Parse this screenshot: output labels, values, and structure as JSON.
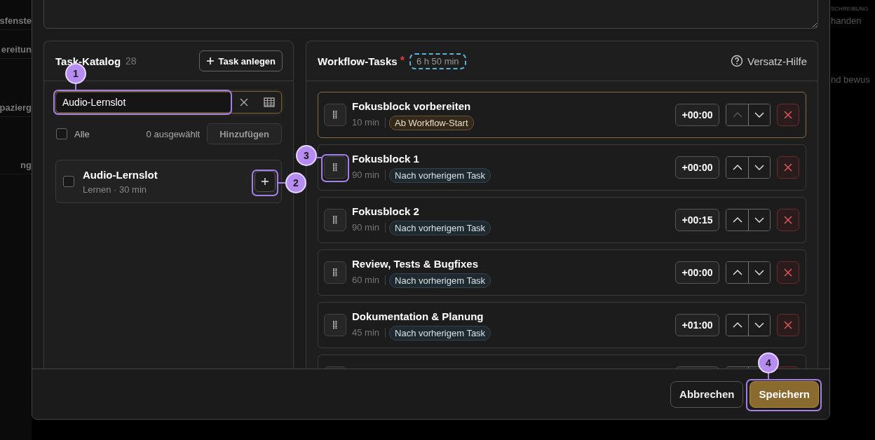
{
  "backdrop": {
    "left_rows": [
      "sfenste",
      "ereitun",
      "pazierg",
      "ng"
    ],
    "right_header": "SCHREIBUNG",
    "right_rows": [
      "handen",
      "nd bewus"
    ]
  },
  "catalog": {
    "title": "Task-Katalog",
    "count": "28",
    "create_button": "Task anlegen",
    "search": {
      "value": "Audio-Lernslot"
    },
    "select_all": {
      "label": "Alle",
      "checked": false
    },
    "selected_count": "0 ausgewählt",
    "add_button": {
      "label": "Hinzufügen",
      "disabled": true
    },
    "items": [
      {
        "title": "Audio-Lernslot",
        "subtitle": "Lernen · 30 min",
        "checked": false
      }
    ]
  },
  "workflow": {
    "title": "Workflow-Tasks",
    "required_mark": "*",
    "total": "6 h 50 min",
    "help_link": "Versatz-Hilfe",
    "tasks": [
      {
        "title": "Fokusblock vorbereiten",
        "duration": "10 min",
        "anchor": {
          "kind": "start",
          "label": "Ab Workflow-Start"
        },
        "offset": "+00:00",
        "selected": true,
        "up_disabled": true
      },
      {
        "title": "Fokusblock 1",
        "duration": "90 min",
        "anchor": {
          "kind": "previous",
          "label": "Nach vorherigem Task"
        },
        "offset": "+00:00",
        "selected": false,
        "up_disabled": false
      },
      {
        "title": "Fokusblock 2",
        "duration": "90 min",
        "anchor": {
          "kind": "previous",
          "label": "Nach vorherigem Task"
        },
        "offset": "+00:15",
        "selected": false,
        "up_disabled": false
      },
      {
        "title": "Review, Tests & Bugfixes",
        "duration": "60 min",
        "anchor": {
          "kind": "previous",
          "label": "Nach vorherigem Task"
        },
        "offset": "+00:00",
        "selected": false,
        "up_disabled": false
      },
      {
        "title": "Dokumentation & Planung",
        "duration": "45 min",
        "anchor": {
          "kind": "previous",
          "label": "Nach vorherigem Task"
        },
        "offset": "+01:00",
        "selected": false,
        "up_disabled": false
      },
      {
        "selected": false
      }
    ]
  },
  "footer": {
    "cancel": "Abbrechen",
    "save": "Speichern"
  },
  "annotations": [
    {
      "number": "1"
    },
    {
      "number": "2"
    },
    {
      "number": "3"
    },
    {
      "number": "4"
    }
  ]
}
